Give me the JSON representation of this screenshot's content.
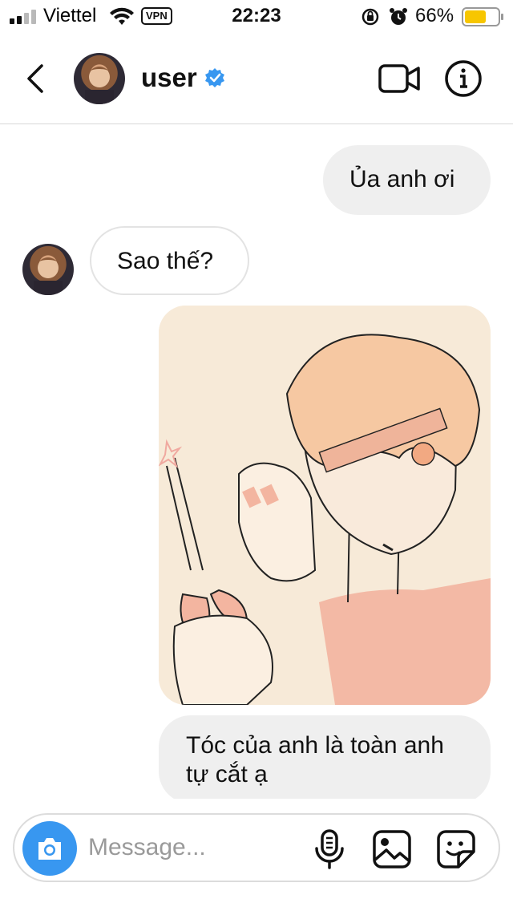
{
  "status_bar": {
    "carrier": "Viettel",
    "vpn": "VPN",
    "time": "22:23",
    "battery_percent": "66%",
    "battery_level": 0.66,
    "signal_bars": 2
  },
  "header": {
    "username": "user",
    "verified": true
  },
  "messages": [
    {
      "from": "me",
      "text": "Ủa anh ơi"
    },
    {
      "from": "user",
      "text": "Sao thế?"
    },
    {
      "from": "me",
      "type": "image"
    },
    {
      "from": "me",
      "text_line1": "Tóc của anh là toàn anh",
      "text_line2": "tự cắt ạ"
    }
  ],
  "composer": {
    "placeholder": "Message..."
  },
  "colors": {
    "accent": "#3897f0",
    "verified": "#3897f0",
    "battery": "#f7c600",
    "bubble_grey": "#efefef"
  },
  "icons": [
    "signal-icon",
    "wifi-icon",
    "lock-rotation-icon",
    "alarm-icon",
    "battery-icon",
    "back-icon",
    "video-call-icon",
    "info-icon",
    "camera-icon",
    "microphone-icon",
    "gallery-icon",
    "sticker-icon",
    "verified-badge-icon"
  ]
}
